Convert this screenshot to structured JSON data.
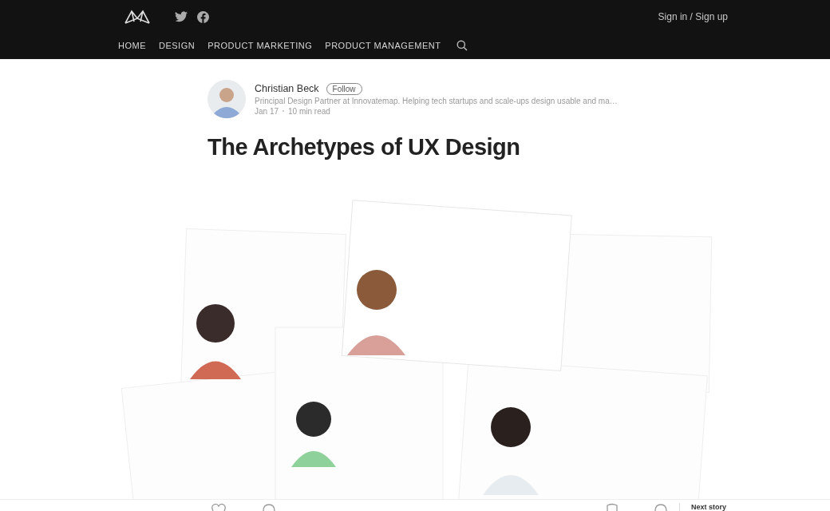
{
  "header": {
    "sign_in": "Sign in / Sign up",
    "nav": [
      {
        "label": "HOME"
      },
      {
        "label": "DESIGN"
      },
      {
        "label": "PRODUCT MARKETING"
      },
      {
        "label": "PRODUCT MANAGEMENT"
      }
    ]
  },
  "author": {
    "name": "Christian Beck",
    "follow": "Follow",
    "bio": "Principal Design Partner at Innovatemap. Helping tech startups and scale-ups design usable and ma…",
    "date": "Jan 17",
    "read_time": "10 min read"
  },
  "article": {
    "title": "The Archetypes of UX Design"
  },
  "footer": {
    "next": "Next story"
  }
}
